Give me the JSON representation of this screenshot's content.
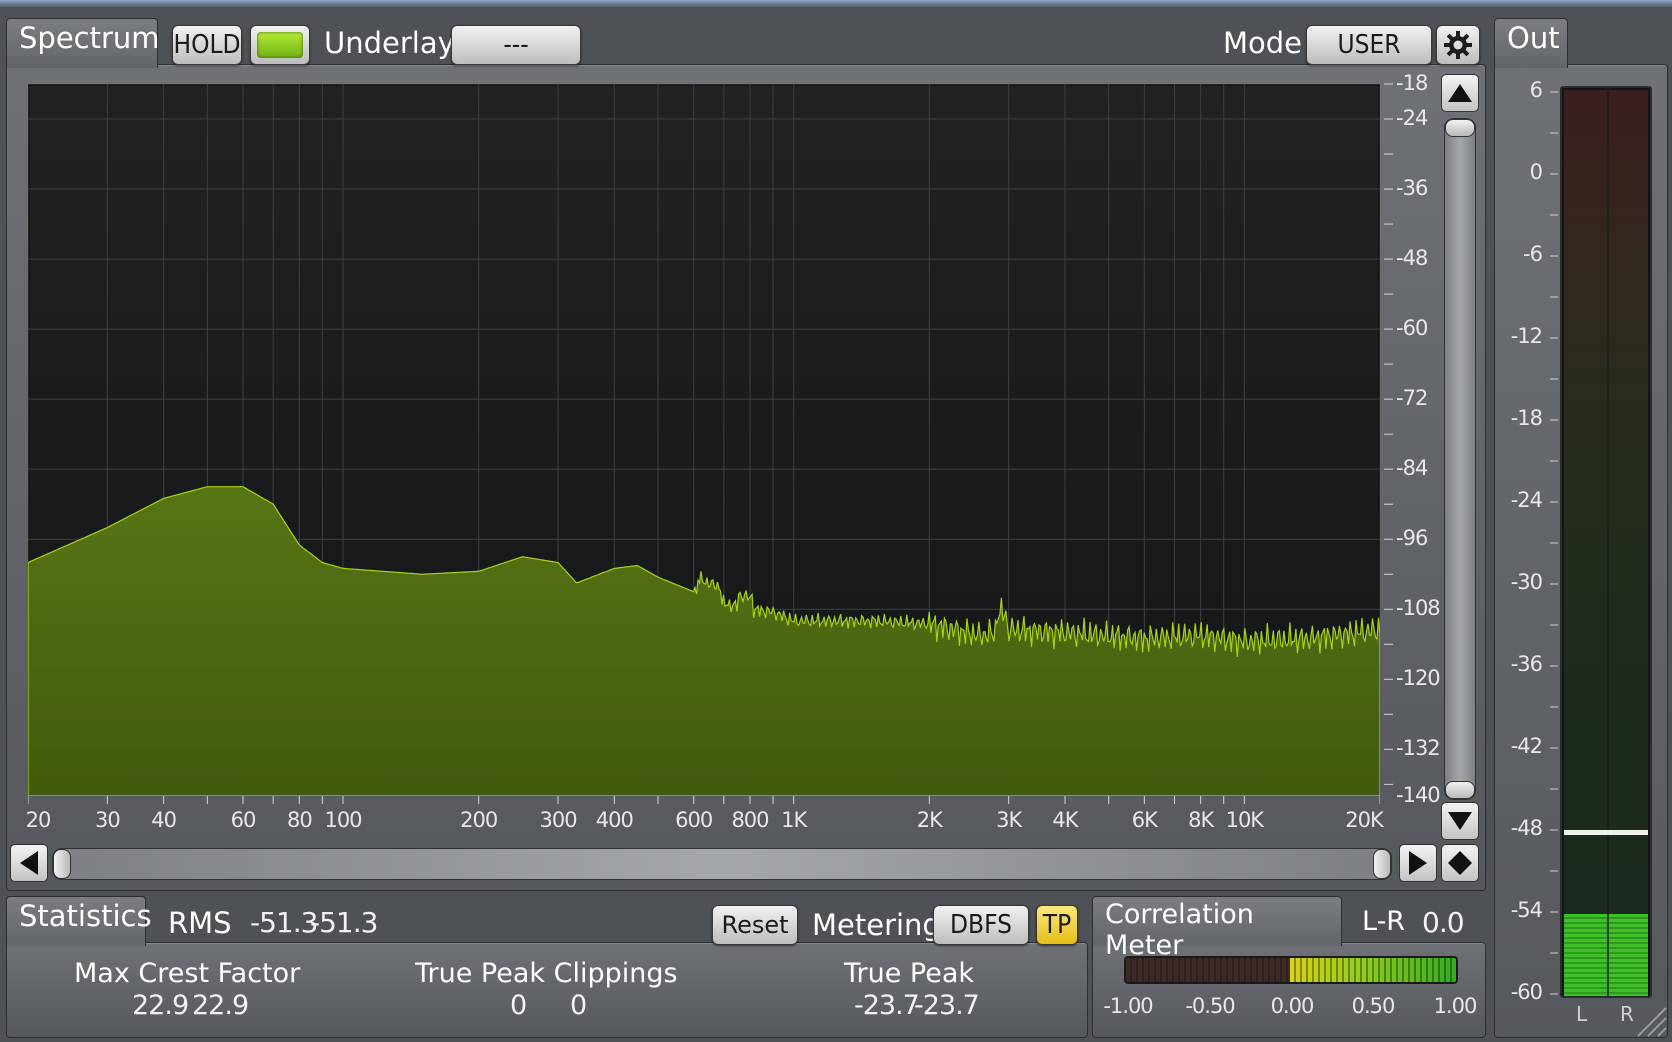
{
  "spectrum": {
    "tab_label": "Spectrum",
    "hold_label": "HOLD",
    "underlay_label": "Underlay",
    "underlay_value": "---",
    "mode_label": "Mode",
    "mode_value": "USER",
    "db_ticks": [
      "-18",
      "-24",
      "-36",
      "-48",
      "-60",
      "-72",
      "-84",
      "-96",
      "-108",
      "-120",
      "-132",
      "-140"
    ],
    "freq_ticks": [
      "20",
      "30",
      "40",
      "60",
      "80",
      "100",
      "200",
      "300",
      "400",
      "600",
      "800",
      "1K",
      "2K",
      "3K",
      "4K",
      "6K",
      "8K",
      "10K",
      "20K"
    ],
    "fill_color": "#4f6a12",
    "line_color": "#a8d21a"
  },
  "out": {
    "tab_label": "Out",
    "scale": [
      "6",
      "0",
      "-6",
      "-12",
      "-18",
      "-24",
      "-30",
      "-36",
      "-42",
      "-48",
      "-54",
      "-60"
    ],
    "channels": [
      "L",
      "R"
    ],
    "level_db": -54,
    "peak_hold_db": -48
  },
  "statistics": {
    "tab_label": "Statistics",
    "rms_label": "RMS",
    "rms_l": "-51.3",
    "rms_r": "-51.3",
    "reset_label": "Reset",
    "metering_label": "Metering",
    "metering_value": "DBFS",
    "tp_label": "TP",
    "max_crest_label": "Max Crest Factor",
    "max_crest_l": "22.9",
    "max_crest_r": "22.9",
    "tp_clip_label": "True Peak Clippings",
    "tp_clip_l": "0",
    "tp_clip_r": "0",
    "true_peak_label": "True Peak",
    "true_peak_l": "-23.7",
    "true_peak_r": "-23.7"
  },
  "correlation": {
    "tab_label": "Correlation Meter",
    "lr_label": "L-R",
    "lr_value": "0.0",
    "scale": [
      "-1.00",
      "-0.50",
      "0.00",
      "0.50",
      "1.00"
    ]
  },
  "colors": {
    "hold_indicator": "#8fd11a",
    "tp_active": "#f2cf2a",
    "meter_green": "#3fbf2a"
  }
}
